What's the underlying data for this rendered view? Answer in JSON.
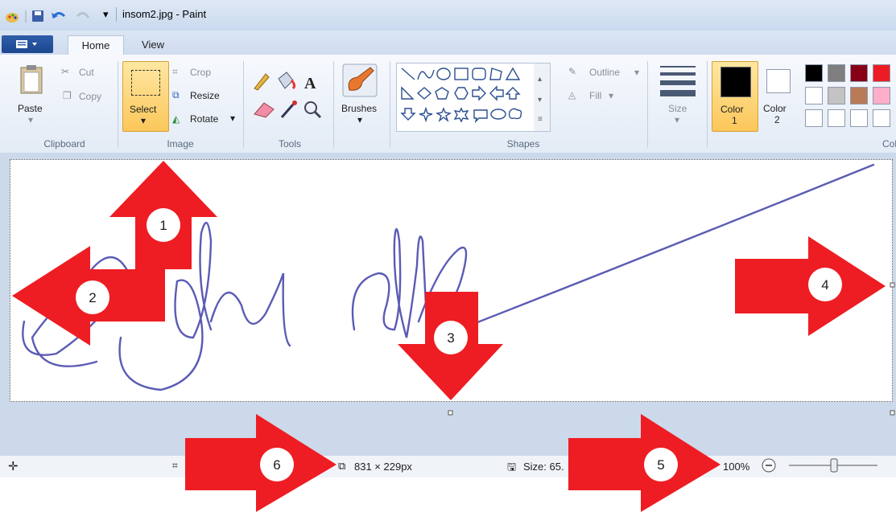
{
  "window": {
    "title": "insom2.jpg - Paint"
  },
  "tabs": [
    {
      "label": "Home"
    },
    {
      "label": "View"
    }
  ],
  "clipboard": {
    "paste": "Paste",
    "cut": "Cut",
    "copy": "Copy",
    "group": "Clipboard"
  },
  "image": {
    "select": "Select",
    "crop": "Crop",
    "resize": "Resize",
    "rotate": "Rotate",
    "group": "Image"
  },
  "tools": {
    "group": "Tools"
  },
  "brushes": {
    "label": "Brushes"
  },
  "shapes": {
    "outline": "Outline",
    "fill": "Fill",
    "group": "Shapes"
  },
  "size": {
    "label": "Size"
  },
  "colors": {
    "color1": "Color",
    "color1_num": "1",
    "color2": "Color",
    "color2_num": "2",
    "group": "Col",
    "palette": [
      "#000000",
      "#7f7f7f",
      "#880015",
      "#ed1c24",
      "#ffffff",
      "#c3c3c3",
      "#b97a57",
      "#ffaec9"
    ]
  },
  "status": {
    "dims": "831 × 229px",
    "size": "Size: 65.",
    "zoom": "100%"
  },
  "arrows": [
    {
      "label": "1"
    },
    {
      "label": "2"
    },
    {
      "label": "3"
    },
    {
      "label": "4"
    },
    {
      "label": "5"
    },
    {
      "label": "6"
    }
  ],
  "accent": {
    "arrow_red": "#ee1d23",
    "ink": "#5b5bb5"
  }
}
